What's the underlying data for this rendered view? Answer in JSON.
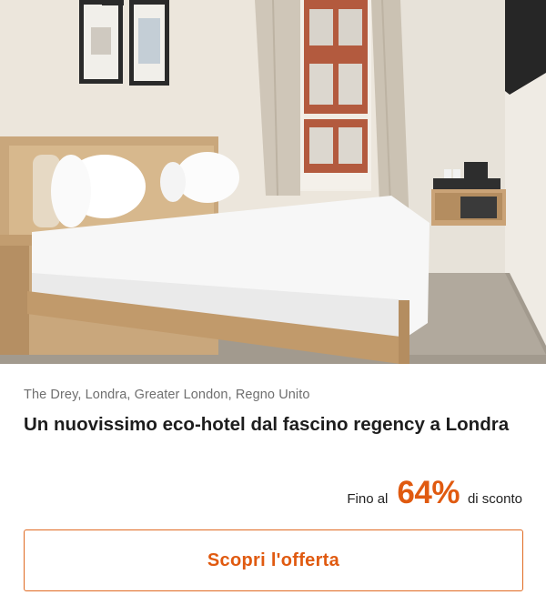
{
  "offer": {
    "image_alt": "Camera d'albergo con letto matrimoniale",
    "location": "The Drey, Londra, Greater London, Regno Unito",
    "title": "Un nuovissimo eco-hotel dal fascino regency a Londra",
    "discount": {
      "prefix": "Fino al",
      "value": "64%",
      "suffix": "di sconto"
    },
    "cta_label": "Scopri l'offerta"
  },
  "colors": {
    "accent": "#e05a10",
    "border": "#e06a22",
    "title": "#1d1d1d",
    "location": "#6f6f6f"
  }
}
